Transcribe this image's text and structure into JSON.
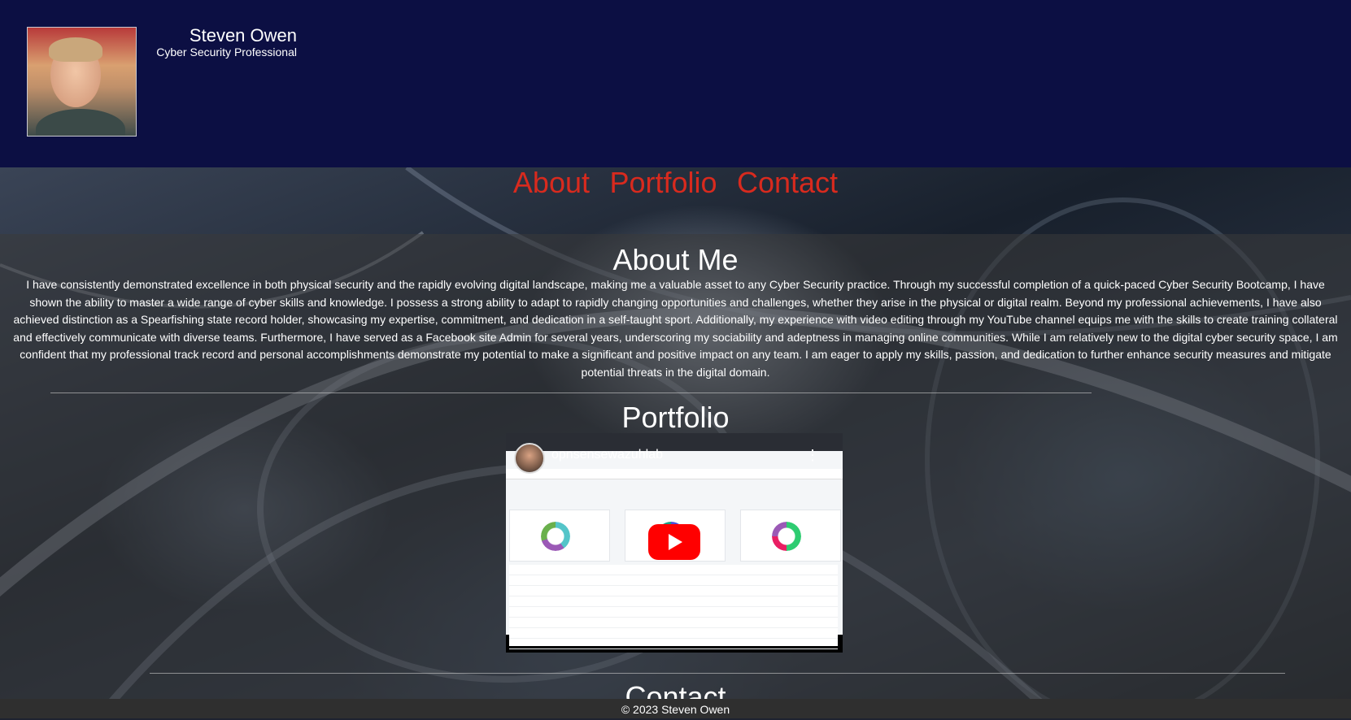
{
  "header": {
    "name": "Steven Owen",
    "role": "Cyber Security Professional",
    "background_color": "#0c0f43"
  },
  "nav": {
    "items": [
      "About",
      "Portfolio",
      "Contact"
    ],
    "link_color": "#d82a1e"
  },
  "about": {
    "title": "About Me",
    "text": "I have consistently demonstrated excellence in both physical security and the rapidly evolving digital landscape, making me a valuable asset to any Cyber Security practice. Through my successful completion of a quick-paced Cyber Security Bootcamp, I have shown the ability to master a wide range of cyber skills and knowledge. I possess a strong ability to adapt to rapidly changing opportunities and challenges, whether they arise in the physical or digital realm. Beyond my professional achievements, I have also achieved distinction as a Spearfishing state record holder, showcasing my expertise, commitment, and dedication in a self-taught sport. Additionally, my experience with video editing through my YouTube channel equips me with the skills to create training collateral and effectively communicate with diverse teams. Furthermore, I have served as a Facebook site Admin for several years, underscoring my sociability and adeptness in managing online communities. While I am relatively new to the digital cyber security space, I am confident that my professional track record and personal accomplishments demonstrate my potential to make a significant and positive impact on any team. I am eager to apply my skills, passion, and dedication to further enhance security measures and mitigate potential threats in the digital domain."
  },
  "portfolio": {
    "title": "Portfolio",
    "video": {
      "title": "opnsensewazuhlab",
      "play_color": "#ff0000"
    }
  },
  "contact": {
    "title": "Contact"
  },
  "footer": {
    "text": "© 2023 Steven Owen"
  }
}
